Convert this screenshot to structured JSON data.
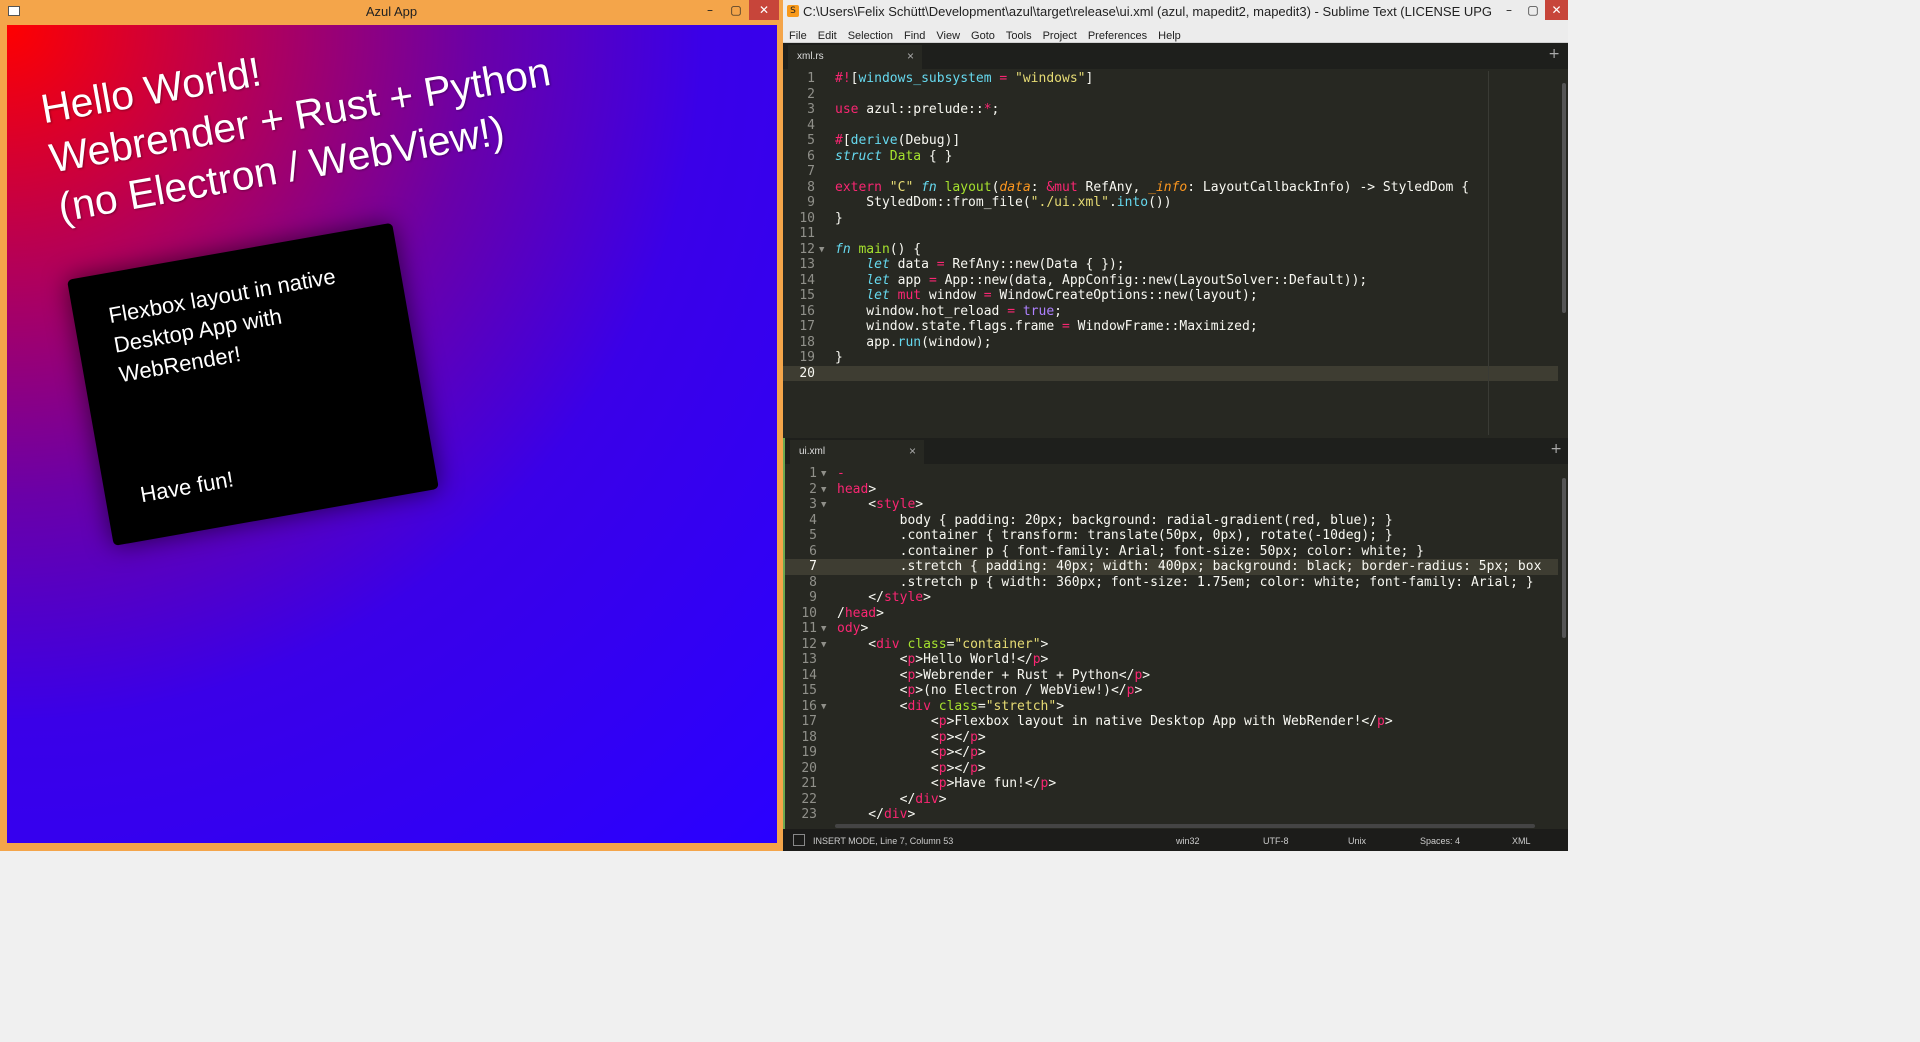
{
  "azul": {
    "title": "Azul App",
    "min_btn": "–",
    "max_btn": "▢",
    "close_btn": "✕",
    "hero_lines": [
      "Hello World!",
      "Webrender + Rust + Python",
      "(no Electron / WebView!)"
    ],
    "card_text": "Flexbox layout in native Desktop App with WebRender!",
    "card_footer": "Have fun!"
  },
  "sublime": {
    "title": "C:\\Users\\Felix Schütt\\Development\\azul\\target\\release\\ui.xml (azul, mapedit2, mapedit3) - Sublime Text (LICENSE UPGRADE ...",
    "min_btn": "–",
    "max_btn": "▢",
    "close_btn": "✕",
    "menu": [
      "File",
      "Edit",
      "Selection",
      "Find",
      "View",
      "Goto",
      "Tools",
      "Project",
      "Preferences",
      "Help"
    ],
    "pane1": {
      "tab": "xml.rs",
      "tab_close": "×",
      "plus": "+",
      "current_line": 20,
      "lines": [
        {
          "n": "1",
          "fold": "",
          "html": "<span class='k'>#!</span>[<span class='c'>windows_subsystem</span> <span class='k'>=</span> <span class='s'>\"windows\"</span>]"
        },
        {
          "n": "2",
          "fold": "",
          "html": ""
        },
        {
          "n": "3",
          "fold": "",
          "html": "<span class='k'>use</span> azul::prelude::<span class='k'>*</span>;"
        },
        {
          "n": "4",
          "fold": "",
          "html": ""
        },
        {
          "n": "5",
          "fold": "",
          "html": "<span class='k'>#</span>[<span class='c'>derive</span>(Debug)]"
        },
        {
          "n": "6",
          "fold": "",
          "html": "<span class='t'>struct</span> <span class='f'>Data</span> { }"
        },
        {
          "n": "7",
          "fold": "",
          "html": ""
        },
        {
          "n": "8",
          "fold": "",
          "html": "<span class='k'>extern</span> <span class='s'>\"C\"</span> <span class='t'>fn</span> <span class='f'>layout</span>(<span class='p'>data</span>: <span class='k'>&amp;mut</span> RefAny, <span class='p'>_info</span>: LayoutCallbackInfo) -&gt; StyledDom {"
        },
        {
          "n": "9",
          "fold": "",
          "html": "    StyledDom::from_file(<span class='s'>\"./ui.xml\"</span>.<span class='c'>into</span>())"
        },
        {
          "n": "10",
          "fold": "",
          "html": "}"
        },
        {
          "n": "11",
          "fold": "",
          "html": ""
        },
        {
          "n": "12",
          "fold": "▼",
          "html": "<span class='t'>fn</span> <span class='f'>main</span>() {"
        },
        {
          "n": "13",
          "fold": "",
          "html": "    <span class='t'>let</span> data <span class='k'>=</span> RefAny::new(Data { });"
        },
        {
          "n": "14",
          "fold": "",
          "html": "    <span class='t'>let</span> app <span class='k'>=</span> App::new(data, AppConfig::new(LayoutSolver::Default));"
        },
        {
          "n": "15",
          "fold": "",
          "html": "    <span class='t'>let</span> <span class='k'>mut</span> window <span class='k'>=</span> WindowCreateOptions::new(layout);"
        },
        {
          "n": "16",
          "fold": "",
          "html": "    window.hot_reload <span class='k'>=</span> <span class='n'>true</span>;"
        },
        {
          "n": "17",
          "fold": "",
          "html": "    window.state.flags.frame <span class='k'>=</span> WindowFrame::Maximized;"
        },
        {
          "n": "18",
          "fold": "",
          "html": "    app.<span class='c'>run</span>(window);"
        },
        {
          "n": "19",
          "fold": "",
          "html": "}"
        },
        {
          "n": "20",
          "fold": "",
          "html": ""
        }
      ]
    },
    "pane2": {
      "tab": "ui.xml",
      "tab_close": "×",
      "plus": "+",
      "current_line": 7,
      "lines": [
        {
          "n": "1",
          "fold": "▼",
          "html": "<span class='k'>-</span>"
        },
        {
          "n": "2",
          "fold": "▼",
          "html": "<span class='k'>head</span>&gt;"
        },
        {
          "n": "3",
          "fold": "▼",
          "html": "    &lt;<span class='k'>style</span>&gt;"
        },
        {
          "n": "4",
          "fold": "",
          "html": "        body { padding: 20px; background: radial-gradient(red, blue); }"
        },
        {
          "n": "5",
          "fold": "",
          "html": "        .container { transform: translate(50px, 0px), rotate(-10deg); }"
        },
        {
          "n": "6",
          "fold": "",
          "html": "        .container p { font-family: Arial; font-size: 50px; color: white; }"
        },
        {
          "n": "7",
          "fold": "",
          "html": "        .stretch { padding: 40px; width: 400px; background: black; border-radius: 5px; box"
        },
        {
          "n": "8",
          "fold": "",
          "html": "        .stretch p { width: 360px; font-size: 1.75em; color: white; font-family: Arial; }"
        },
        {
          "n": "9",
          "fold": "",
          "html": "    &lt;/<span class='k'>style</span>&gt;"
        },
        {
          "n": "10",
          "fold": "",
          "html": "/<span class='k'>head</span>&gt;"
        },
        {
          "n": "11",
          "fold": "▼",
          "html": "<span class='k'>ody</span>&gt;"
        },
        {
          "n": "12",
          "fold": "▼",
          "html": "    &lt;<span class='k'>div</span> <span class='attr'>class</span>=<span class='s'>\"container\"</span>&gt;"
        },
        {
          "n": "13",
          "fold": "",
          "html": "        &lt;<span class='k'>p</span>&gt;Hello World!&lt;/<span class='k'>p</span>&gt;"
        },
        {
          "n": "14",
          "fold": "",
          "html": "        &lt;<span class='k'>p</span>&gt;Webrender + Rust + Python&lt;/<span class='k'>p</span>&gt;"
        },
        {
          "n": "15",
          "fold": "",
          "html": "        &lt;<span class='k'>p</span>&gt;(no Electron / WebView!)&lt;/<span class='k'>p</span>&gt;"
        },
        {
          "n": "16",
          "fold": "▼",
          "html": "        &lt;<span class='k'>div</span> <span class='attr'>class</span>=<span class='s'>\"stretch\"</span>&gt;"
        },
        {
          "n": "17",
          "fold": "",
          "html": "            &lt;<span class='k'>p</span>&gt;Flexbox layout in native Desktop App with WebRender!&lt;/<span class='k'>p</span>&gt;"
        },
        {
          "n": "18",
          "fold": "",
          "html": "            &lt;<span class='k'>p</span>&gt;&lt;/<span class='k'>p</span>&gt;"
        },
        {
          "n": "19",
          "fold": "",
          "html": "            &lt;<span class='k'>p</span>&gt;&lt;/<span class='k'>p</span>&gt;"
        },
        {
          "n": "20",
          "fold": "",
          "html": "            &lt;<span class='k'>p</span>&gt;&lt;/<span class='k'>p</span>&gt;"
        },
        {
          "n": "21",
          "fold": "",
          "html": "            &lt;<span class='k'>p</span>&gt;Have fun!&lt;/<span class='k'>p</span>&gt;"
        },
        {
          "n": "22",
          "fold": "",
          "html": "        &lt;/<span class='k'>div</span>&gt;"
        },
        {
          "n": "23",
          "fold": "",
          "html": "    &lt;/<span class='k'>div</span>&gt;"
        }
      ]
    },
    "status": {
      "mode": "INSERT MODE, Line 7, Column 53",
      "platform": "win32",
      "encoding": "UTF-8",
      "line_endings": "Unix",
      "indent": "Spaces: 4",
      "syntax": "XML"
    }
  }
}
